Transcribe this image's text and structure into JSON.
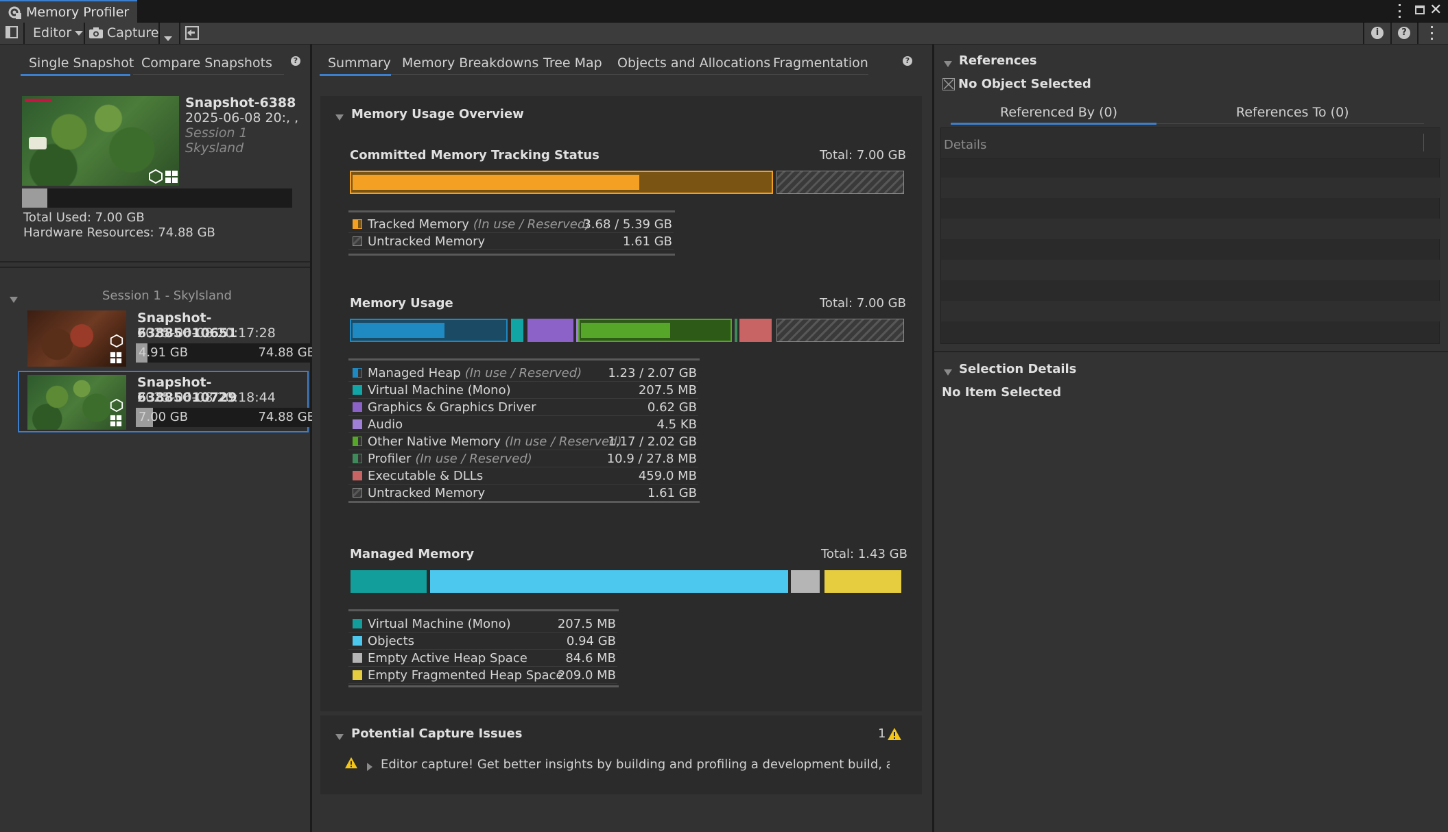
{
  "window": {
    "title": "Memory Profiler"
  },
  "toolbar": {
    "editor_label": "Editor",
    "capture_label": "Capture"
  },
  "left": {
    "tabs": [
      "Single Snapshot",
      "Compare Snapshots"
    ],
    "selected": {
      "name": "Snapshot-6388",
      "date": "2025-06-08 20:, ,",
      "session": "Session 1",
      "project": "Skysland",
      "total_used": "Total Used: 7.00 GB",
      "hardware": "Hardware Resources: 74.88 GB",
      "usage_fraction": 0.094
    },
    "session_header": "Session 1 - Skylsland",
    "snapshots": [
      {
        "name": "Snapshot-63885010651",
        "date": "2025-06-08 20:17:28",
        "used": "4.91 GB",
        "total": "74.88 GB",
        "fraction": 0.066
      },
      {
        "name": "Snapshot-63885010729",
        "date": "2025-06-08 20:18:44",
        "used": "7.00 GB",
        "total": "74.88 GB",
        "fraction": 0.094
      }
    ]
  },
  "mid": {
    "tabs": [
      "Summary",
      "Memory Breakdowns",
      "Tree Map",
      "Objects and Allocations",
      "Fragmentation"
    ],
    "overview_title": "Memory Usage Overview",
    "committed": {
      "title": "Committed Memory Tracking Status",
      "total": "Total: 7.00 GB",
      "legend": [
        {
          "label": "Tracked Memory",
          "dim": "(In use / Reserved)",
          "value": "3.68 / 5.39 GB",
          "color": "#f3a023"
        },
        {
          "label": "Untracked Memory",
          "dim": "",
          "value": "1.61 GB",
          "color": "#8a8a8a"
        }
      ]
    },
    "usage": {
      "title": "Memory Usage",
      "total": "Total: 7.00 GB",
      "legend": [
        {
          "label": "Managed Heap",
          "dim": "(In use / Reserved)",
          "value": "1.23 / 2.07 GB",
          "color": "#1f89c2"
        },
        {
          "label": "Virtual Machine (Mono)",
          "dim": "",
          "value": "207.5 MB",
          "color": "#12a5a5"
        },
        {
          "label": "Graphics & Graphics Driver",
          "dim": "",
          "value": "0.62 GB",
          "color": "#8c62c8"
        },
        {
          "label": "Audio",
          "dim": "",
          "value": "4.5 KB",
          "color": "#a07fd6"
        },
        {
          "label": "Other Native Memory",
          "dim": "(In use / Reserved)",
          "value": "1.17 / 2.02 GB",
          "color": "#56a629"
        },
        {
          "label": "Profiler",
          "dim": "(In use / Reserved)",
          "value": "10.9 / 27.8 MB",
          "color": "#3f8a5a"
        },
        {
          "label": "Executable & DLLs",
          "dim": "",
          "value": "459.0 MB",
          "color": "#c86464"
        },
        {
          "label": "Untracked Memory",
          "dim": "",
          "value": "1.61 GB",
          "color": "#8a8a8a"
        }
      ]
    },
    "managed": {
      "title": "Managed Memory",
      "total": "Total: 1.43 GB",
      "legend": [
        {
          "label": "Virtual Machine (Mono)",
          "value": "207.5 MB",
          "color": "#129e9a"
        },
        {
          "label": "Objects",
          "value": "0.94 GB",
          "color": "#4cc7ee"
        },
        {
          "label": "Empty Active Heap Space",
          "value": "84.6 MB",
          "color": "#b5b5b5"
        },
        {
          "label": "Empty Fragmented Heap Space",
          "value": "209.0 MB",
          "color": "#e6cd3f"
        }
      ]
    },
    "issues": {
      "title": "Potential Capture Issues",
      "count": "1",
      "message": "Editor capture! Get better insights by building and profiling a development build, as mei"
    }
  },
  "right": {
    "references_title": "References",
    "no_object": "No Object Selected",
    "tabs": [
      "Referenced By (0)",
      "References To (0)"
    ],
    "details_header": "Details",
    "selection_title": "Selection Details",
    "no_item": "No Item Selected"
  }
}
